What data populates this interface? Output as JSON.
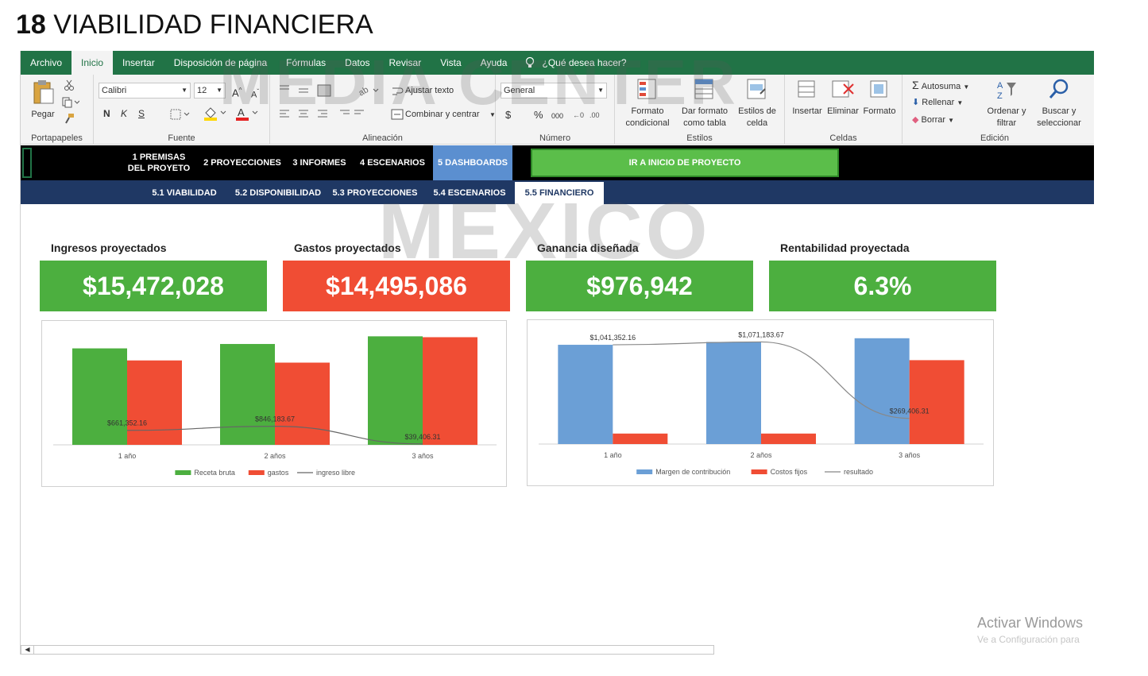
{
  "title": {
    "number": "18",
    "text": "VIABILIDAD FINANCIERA"
  },
  "ribbon_tabs": [
    "Archivo",
    "Inicio",
    "Insertar",
    "Disposición de página",
    "Fórmulas",
    "Datos",
    "Revisar",
    "Vista",
    "Ayuda"
  ],
  "ribbon_active_tab": "Inicio",
  "tell_me": "¿Qué desea hacer?",
  "ribbon": {
    "clipboard": {
      "paste": "Pegar",
      "label": "Portapapeles"
    },
    "font": {
      "name": "Calibri",
      "size": "12",
      "bold": "N",
      "italic": "K",
      "underline": "S",
      "label": "Fuente"
    },
    "alignment": {
      "wrap": "Ajustar texto",
      "merge": "Combinar y centrar",
      "label": "Alineación"
    },
    "number": {
      "format": "General",
      "currency": "$",
      "percent": "%",
      "thousands": "000",
      "label": "Número"
    },
    "styles": {
      "conditional_1": "Formato",
      "conditional_2": "condicional",
      "table_1": "Dar formato",
      "table_2": "como tabla",
      "cell_1": "Estilos de",
      "cell_2": "celda",
      "label": "Estilos"
    },
    "cells": {
      "insert": "Insertar",
      "delete": "Eliminar",
      "format": "Formato",
      "label": "Celdas"
    },
    "editing": {
      "autosum": "Autosuma",
      "fill": "Rellenar",
      "clear": "Borrar",
      "sort_1": "Ordenar y",
      "sort_2": "filtrar",
      "find_1": "Buscar y",
      "find_2": "seleccionar",
      "label": "Edición"
    }
  },
  "nav": {
    "items": [
      "1 PREMISAS",
      "DEL PROYETO",
      "2 PROYECCIONES",
      "3 INFORMES",
      "4 ESCENARIOS",
      "5 DASHBOARDS"
    ],
    "go_button": "IR A INICIO DE PROYECTO"
  },
  "subnav": [
    "5.1 VIABILIDAD",
    "5.2 DISPONIBILIDAD",
    "5.3 PROYECCIONES",
    "5.4 ESCENARIOS",
    "5.5 FINANCIERO"
  ],
  "kpis": [
    {
      "label": "Ingresos proyectados",
      "value": "$15,472,028",
      "color": "#4caf3f"
    },
    {
      "label": "Gastos proyectados",
      "value": "$14,495,086",
      "color": "#f04d34"
    },
    {
      "label": "Ganancia diseñada",
      "value": "$976,942",
      "color": "#4caf3f"
    },
    {
      "label": "Rentabilidad proyectada",
      "value": "6.3%",
      "color": "#4caf3f"
    }
  ],
  "watermark": {
    "line1": "MEDIA CENTER",
    "line2": "MEXICO"
  },
  "windows_notice": {
    "title": "Activar Windows",
    "subtitle": "Ve a Configuración para"
  },
  "chart_data": [
    {
      "type": "bar",
      "categories": [
        "1 año",
        "2 años",
        "3 años"
      ],
      "series": [
        {
          "name": "Receta bruta",
          "kind": "bar",
          "color": "#4caf3f",
          "values": [
            4400000,
            4600000,
            4950000
          ]
        },
        {
          "name": "gastos",
          "kind": "bar",
          "color": "#f04d34",
          "values": [
            3850000,
            3750000,
            4910000
          ]
        },
        {
          "name": "ingreso libre",
          "kind": "line",
          "color": "#666666",
          "values": [
            661352.16,
            846183.67,
            39406.31
          ],
          "labels": [
            "$661,352.16",
            "$846,183.67",
            "$39,406.31"
          ]
        }
      ],
      "ylim": [
        0,
        5000000
      ],
      "legend": "bottom"
    },
    {
      "type": "bar",
      "categories": [
        "1 año",
        "2 años",
        "3 años"
      ],
      "series": [
        {
          "name": "Margen de contribución",
          "kind": "bar",
          "color": "#6b9fd6",
          "values": [
            1041352.16,
            1071183.67,
            1110000
          ]
        },
        {
          "name": "Costos fijos",
          "kind": "bar",
          "color": "#f04d34",
          "values": [
            110000,
            110000,
            880000
          ]
        },
        {
          "name": "resultado",
          "kind": "line",
          "color": "#888888",
          "values": [
            1041352.16,
            1071183.67,
            269406.31
          ],
          "labels": [
            "$1,041,352.16",
            "$1,071,183.67",
            "$269,406.31"
          ]
        }
      ],
      "ylim": [
        0,
        1150000
      ],
      "legend": "bottom"
    }
  ]
}
